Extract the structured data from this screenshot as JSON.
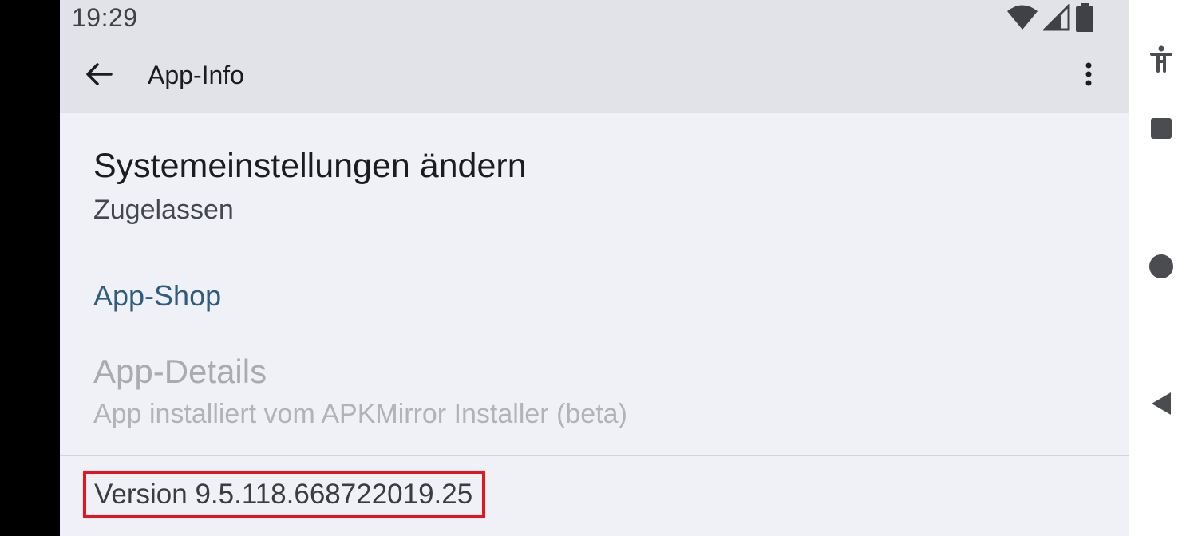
{
  "status_bar": {
    "time": "19:29",
    "icons": [
      "wifi-icon",
      "cell-signal-icon",
      "battery-icon"
    ]
  },
  "app_bar": {
    "title": "App-Info",
    "back_icon": "arrow-back-icon",
    "overflow_icon": "more-vert-icon"
  },
  "modify_settings": {
    "title": "Systemeinstellungen ändern",
    "summary": "Zugelassen"
  },
  "app_store_section": {
    "header": "App-Shop"
  },
  "app_details": {
    "title": "App-Details",
    "summary": "App installiert vom APKMirror Installer (beta)"
  },
  "version": {
    "text": "Version 9.5.118.668722019.25",
    "highlight_color": "#e8131b"
  },
  "nav_bar": {
    "buttons": [
      "accessibility-icon",
      "recents-icon",
      "home-icon",
      "back-icon"
    ]
  },
  "colors": {
    "app_bar_bg": "#e1e3e9",
    "screen_bg": "#eff1f6",
    "accent": "#2f5d7f"
  }
}
